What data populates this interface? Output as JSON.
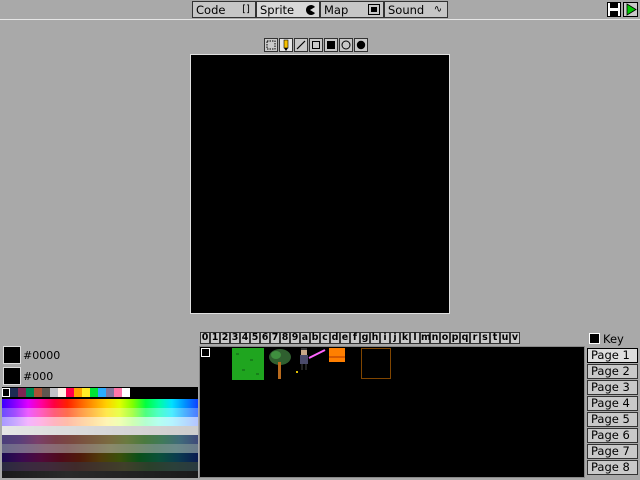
{
  "tabs": [
    {
      "label": "Code",
      "icon": "[]"
    },
    {
      "label": "Sprite",
      "icon": "pacman"
    },
    {
      "label": "Map",
      "icon": "map"
    },
    {
      "label": "Sound",
      "icon": "∿"
    }
  ],
  "colors": {
    "primary_hex": "#0000",
    "secondary_hex": "#000"
  },
  "sprite_indices": [
    "0",
    "1",
    "2",
    "3",
    "4",
    "5",
    "6",
    "7",
    "8",
    "9",
    "a",
    "b",
    "c",
    "d",
    "e",
    "f",
    "g",
    "h",
    "i",
    "j",
    "k",
    "l",
    "m",
    "n",
    "o",
    "p",
    "q",
    "r",
    "s",
    "t",
    "u",
    "v"
  ],
  "key_label": "Key",
  "pages": [
    "Page 1",
    "Page 2",
    "Page 3",
    "Page 4",
    "Page 5",
    "Page 6",
    "Page 7",
    "Page 8"
  ],
  "palette_top": [
    "#000000",
    "#1d2b53",
    "#7e2553",
    "#008751",
    "#ab5236",
    "#5f574f",
    "#c2c3c7",
    "#fff1e8",
    "#ff004d",
    "#ffa300",
    "#ffec27",
    "#00e436",
    "#29adff",
    "#83769c",
    "#ff77a8",
    "#ffffff"
  ]
}
